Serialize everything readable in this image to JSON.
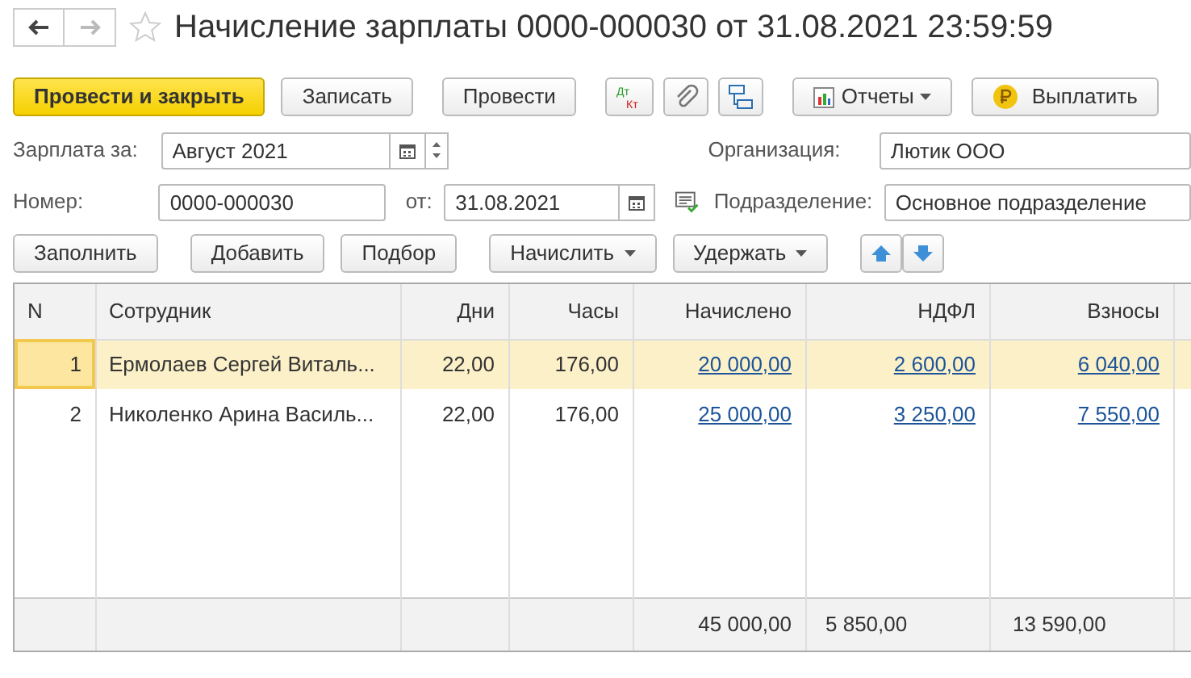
{
  "nav": {
    "back_disabled": false,
    "forward_disabled": true,
    "favorite": false
  },
  "title": "Начисление зарплаты 0000-000030 от 31.08.2021 23:59:59",
  "toolbar": [
    {
      "kind": "primary",
      "label": "Провести и закрыть"
    },
    {
      "kind": "text",
      "label": "Записать"
    },
    {
      "kind": "text",
      "label": "Провести"
    },
    {
      "kind": "dtkt",
      "debit": "Дт",
      "credit": "Кт"
    },
    {
      "kind": "attach"
    },
    {
      "kind": "structure"
    },
    {
      "kind": "reports",
      "label": "Отчеты"
    },
    {
      "kind": "pay",
      "label": "Выплатить"
    }
  ],
  "form": {
    "period_label": "Зарплата за:",
    "period": "Август 2021",
    "number_label": "Номер:",
    "number": "0000-000030",
    "date_label": "от:",
    "date": "31.08.2021",
    "org_label": "Организация:",
    "org": "Лютик ООО",
    "dept_label": "Подразделение:",
    "dept": "Основное подразделение"
  },
  "table_buttons": [
    {
      "kind": "text",
      "label": "Заполнить"
    },
    {
      "kind": "text",
      "label": "Добавить"
    },
    {
      "kind": "text",
      "label": "Подбор"
    },
    {
      "kind": "menu",
      "label": "Начислить"
    },
    {
      "kind": "menu",
      "label": "Удержать"
    }
  ],
  "table": {
    "columns": [
      "N",
      "Сотрудник",
      "Дни",
      "Часы",
      "Начислено",
      "НДФЛ",
      "Взносы"
    ],
    "rows": [
      {
        "selected": true,
        "cells": [
          "1",
          "Ермолаев Сергей Виталь...",
          "22,00",
          "176,00",
          "20 000,00",
          "2 600,00",
          "6 040,00"
        ]
      },
      {
        "selected": false,
        "cells": [
          "2",
          "Николенко Арина Василь...",
          "22,00",
          "176,00",
          "25 000,00",
          "3 250,00",
          "7 550,00"
        ]
      }
    ],
    "totals": {
      "accrued": "45 000,00",
      "ndfl": "5 850,00",
      "contributions": "13 590,00"
    }
  }
}
